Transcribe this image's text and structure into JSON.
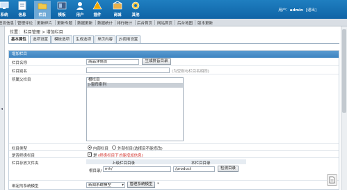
{
  "topnav": [
    {
      "label": "系统",
      "icon": "system-icon",
      "color": "#4a90d9"
    },
    {
      "label": "信息",
      "icon": "info-icon",
      "color": "#ffffff"
    },
    {
      "label": "栏目",
      "icon": "column-folder-icon",
      "color": "#f2c94c"
    },
    {
      "label": "模板",
      "icon": "template-icon",
      "color": "#3e5f8a"
    },
    {
      "label": "用户",
      "icon": "user-icon",
      "color": "#2d7fc6"
    },
    {
      "label": "插件",
      "icon": "plugin-icon",
      "color": "#f2a900"
    },
    {
      "label": "商城",
      "icon": "shop-icon",
      "color": "#e8b04a"
    },
    {
      "label": "其他",
      "icon": "gear-icon",
      "color": "#f2c94c"
    }
  ],
  "user": {
    "prefix": "用户：",
    "name": "admin",
    "logout": "[退出]"
  },
  "menubar": [
    "签发信息",
    "管理评论",
    "更新碎片",
    "更新专题",
    "数据更新",
    "数据统计",
    "排行统计",
    "后台首页",
    "网站首页",
    "后台地图",
    "版本更新"
  ],
  "breadcrumb": "位置： 栏目管理 > 增加栏目",
  "tabs": [
    "基本属性",
    "选项设置",
    "模板选项",
    "生成选项",
    "单页内容",
    "JS调用设置"
  ],
  "panel_title": "增加栏目",
  "form": {
    "name_label": "栏目名称",
    "name_value": "商品详情页",
    "pinyin_button": "生成拼音目录",
    "alias_label": "栏目别名",
    "alias_hint": "(为空则与栏目名相同)",
    "parent_label": "所属父栏目",
    "parent_options": [
      "根栏目",
      "|-窗帘系列"
    ],
    "type_label": "栏目类型",
    "type_internal": "内部栏目",
    "type_external": "外部栏目(选择后不能修改)",
    "final_label": "是否终极栏目",
    "final_yes": "是",
    "final_hint": "(终极栏目下才能增加信息)",
    "dir_label": "栏目存放文件夹",
    "dir_parent_header": "上级栏目目录",
    "dir_self_header": "本栏目目录",
    "dir_root": "根目录/",
    "dir_parent_value": "mh/",
    "dir_self_value": "/product",
    "dir_check_button": "检测目录",
    "model_label": "绑定的系统模型",
    "model_value": "新闻系统模型",
    "model_manage_button": "管理系统模型"
  },
  "colors": {
    "header": "#1a73b8",
    "accent_red": "#d2302a"
  }
}
